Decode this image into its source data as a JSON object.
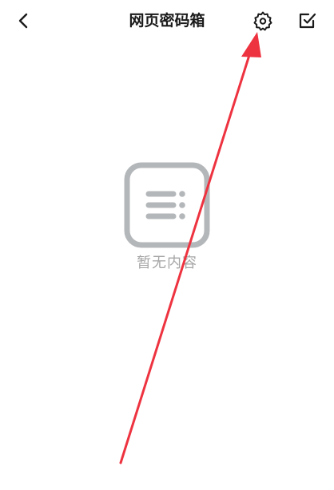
{
  "header": {
    "title": "网页密码箱",
    "back_icon": "chevron-left-icon",
    "settings_icon": "gear-icon",
    "edit_icon": "checkbox-edit-icon"
  },
  "empty_state": {
    "icon": "list-icon",
    "text": "暂无内容"
  },
  "colors": {
    "title": "#1a1a1a",
    "empty_icon": "#b4b7ba",
    "empty_text": "#a6a6a6",
    "annotation": "#ee3340"
  }
}
